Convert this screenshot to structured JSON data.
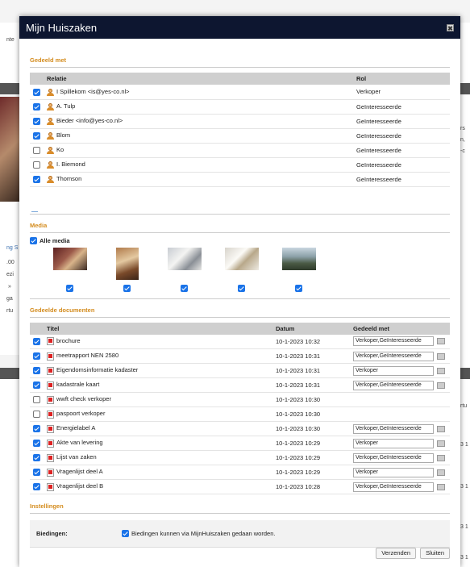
{
  "dialog": {
    "title": "Mijn Huiszaken",
    "close_symbol": "✖"
  },
  "background": {
    "fragments_left": [
      "nte",
      "ng S",
      ".00",
      "ezi",
      "»",
      "ga",
      "rtu"
    ],
    "fragments_right": [
      "rs",
      "n,",
      "-c",
      "rtu",
      "3 1",
      "3 1",
      "3 1",
      "3 1"
    ]
  },
  "shared_with": {
    "section_title": "Gedeeld met",
    "columns": [
      "Relatie",
      "Rol"
    ],
    "rows": [
      {
        "checked": true,
        "name": "I Spillekom <is@yes-co.nl>",
        "role": "Verkoper"
      },
      {
        "checked": true,
        "name": "A. Tulp",
        "role": "Geïnteresseerde"
      },
      {
        "checked": true,
        "name": "Bieder <info@yes-co.nl>",
        "role": "Geïnteresseerde"
      },
      {
        "checked": true,
        "name": "Blom",
        "role": "Geïnteresseerde"
      },
      {
        "checked": false,
        "name": "Ko",
        "role": "Geïnteresseerde"
      },
      {
        "checked": false,
        "name": "I. Biemond",
        "role": "Geïnteresseerde"
      },
      {
        "checked": true,
        "name": "Thomson",
        "role": "Geïnteresseerde"
      }
    ]
  },
  "media": {
    "section_title": "Media",
    "all_label": "Alle media",
    "all_checked": true,
    "items": [
      {
        "checked": true,
        "thumb": "t1"
      },
      {
        "checked": true,
        "thumb": "t2"
      },
      {
        "checked": true,
        "thumb": "t3"
      },
      {
        "checked": true,
        "thumb": "t4"
      },
      {
        "checked": true,
        "thumb": "t5"
      }
    ]
  },
  "documents": {
    "section_title": "Gedeelde documenten",
    "columns": [
      "Titel",
      "Datum",
      "Gedeeld met"
    ],
    "rows": [
      {
        "checked": true,
        "title": "brochure",
        "date": "10-1-2023 10:32",
        "shared": "Verkoper,Geïnteresseerde"
      },
      {
        "checked": true,
        "title": "meetrapport NEN 2580",
        "date": "10-1-2023 10:31",
        "shared": "Verkoper,Geïnteresseerde"
      },
      {
        "checked": true,
        "title": "Eigendomsinformatie kadaster",
        "date": "10-1-2023 10:31",
        "shared": "Verkoper"
      },
      {
        "checked": true,
        "title": "kadastrale kaart",
        "date": "10-1-2023 10:31",
        "shared": "Verkoper,Geïnteresseerde"
      },
      {
        "checked": false,
        "title": "wwft check verkoper",
        "date": "10-1-2023 10:30",
        "shared": ""
      },
      {
        "checked": false,
        "title": "paspoort verkoper",
        "date": "10-1-2023 10:30",
        "shared": ""
      },
      {
        "checked": true,
        "title": "Energielabel A",
        "date": "10-1-2023 10:30",
        "shared": "Verkoper,Geïnteresseerde"
      },
      {
        "checked": true,
        "title": "Akte van levering",
        "date": "10-1-2023 10:29",
        "shared": "Verkoper"
      },
      {
        "checked": true,
        "title": "Lijst van zaken",
        "date": "10-1-2023 10:29",
        "shared": "Verkoper,Geïnteresseerde"
      },
      {
        "checked": true,
        "title": "Vragenlijst deel A",
        "date": "10-1-2023 10:29",
        "shared": "Verkoper"
      },
      {
        "checked": true,
        "title": "Vragenlijst deel B",
        "date": "10-1-2023 10:28",
        "shared": "Verkoper,Geïnteresseerde"
      }
    ]
  },
  "settings": {
    "section_title": "Instellingen",
    "label": "Biedingen:",
    "checked": true,
    "text": "Biedingen kunnen via MijnHuiszaken gedaan worden."
  },
  "footer": {
    "send_label": "Verzenden",
    "close_label": "Sluiten"
  }
}
